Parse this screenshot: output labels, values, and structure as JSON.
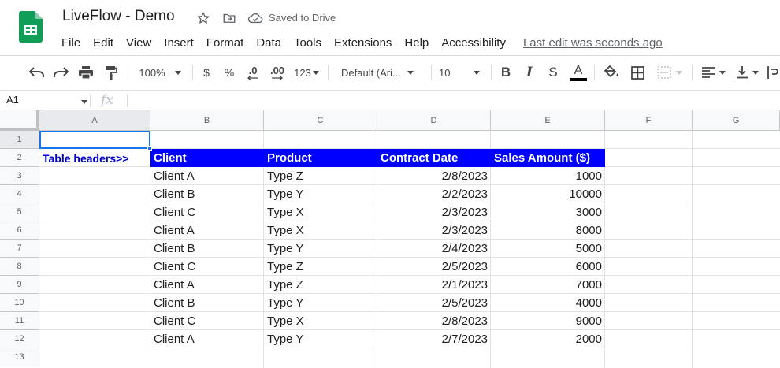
{
  "app": {
    "doc_title": "LiveFlow - Demo",
    "saved_status": "Saved to Drive",
    "last_edit": "Last edit was seconds ago"
  },
  "menu": [
    "File",
    "Edit",
    "View",
    "Insert",
    "Format",
    "Data",
    "Tools",
    "Extensions",
    "Help",
    "Accessibility"
  ],
  "toolbar": {
    "zoom": "100%",
    "currency": "$",
    "percent": "%",
    "decrease_decimal": ".0",
    "increase_decimal": ".00",
    "more_formats": "123",
    "font": "Default (Ari...",
    "font_size": "10",
    "bold": "B",
    "italic": "I",
    "strikethrough": "S",
    "text_color": "A"
  },
  "formula_bar": {
    "cell_ref": "A1",
    "fx": "fx"
  },
  "columns": [
    "A",
    "B",
    "C",
    "D",
    "E",
    "F",
    "G"
  ],
  "rows": [
    "1",
    "2",
    "3",
    "4",
    "5",
    "6",
    "7",
    "8",
    "9",
    "10",
    "11",
    "12",
    "13"
  ],
  "sheet": {
    "note": "Table headers>>",
    "headers": [
      "Client",
      "Product",
      "Contract Date",
      "Sales Amount ($)"
    ],
    "rows": [
      [
        "Client A",
        "Type Z",
        "2/8/2023",
        "1000"
      ],
      [
        "Client B",
        "Type Y",
        "2/2/2023",
        "10000"
      ],
      [
        "Client C",
        "Type X",
        "2/3/2023",
        "3000"
      ],
      [
        "Client A",
        "Type X",
        "2/3/2023",
        "8000"
      ],
      [
        "Client B",
        "Type Y",
        "2/4/2023",
        "5000"
      ],
      [
        "Client C",
        "Type Z",
        "2/5/2023",
        "6000"
      ],
      [
        "Client A",
        "Type Z",
        "2/1/2023",
        "7000"
      ],
      [
        "Client B",
        "Type Y",
        "2/5/2023",
        "4000"
      ],
      [
        "Client C",
        "Type X",
        "2/8/2023",
        "9000"
      ],
      [
        "Client A",
        "Type Y",
        "2/7/2023",
        "2000"
      ]
    ]
  },
  "colors": {
    "header_fill": "#0000ff",
    "header_text": "#ffffff",
    "note_text": "#0000cc",
    "selection": "#1a73e8",
    "sheets_green": "#0f9d58"
  }
}
